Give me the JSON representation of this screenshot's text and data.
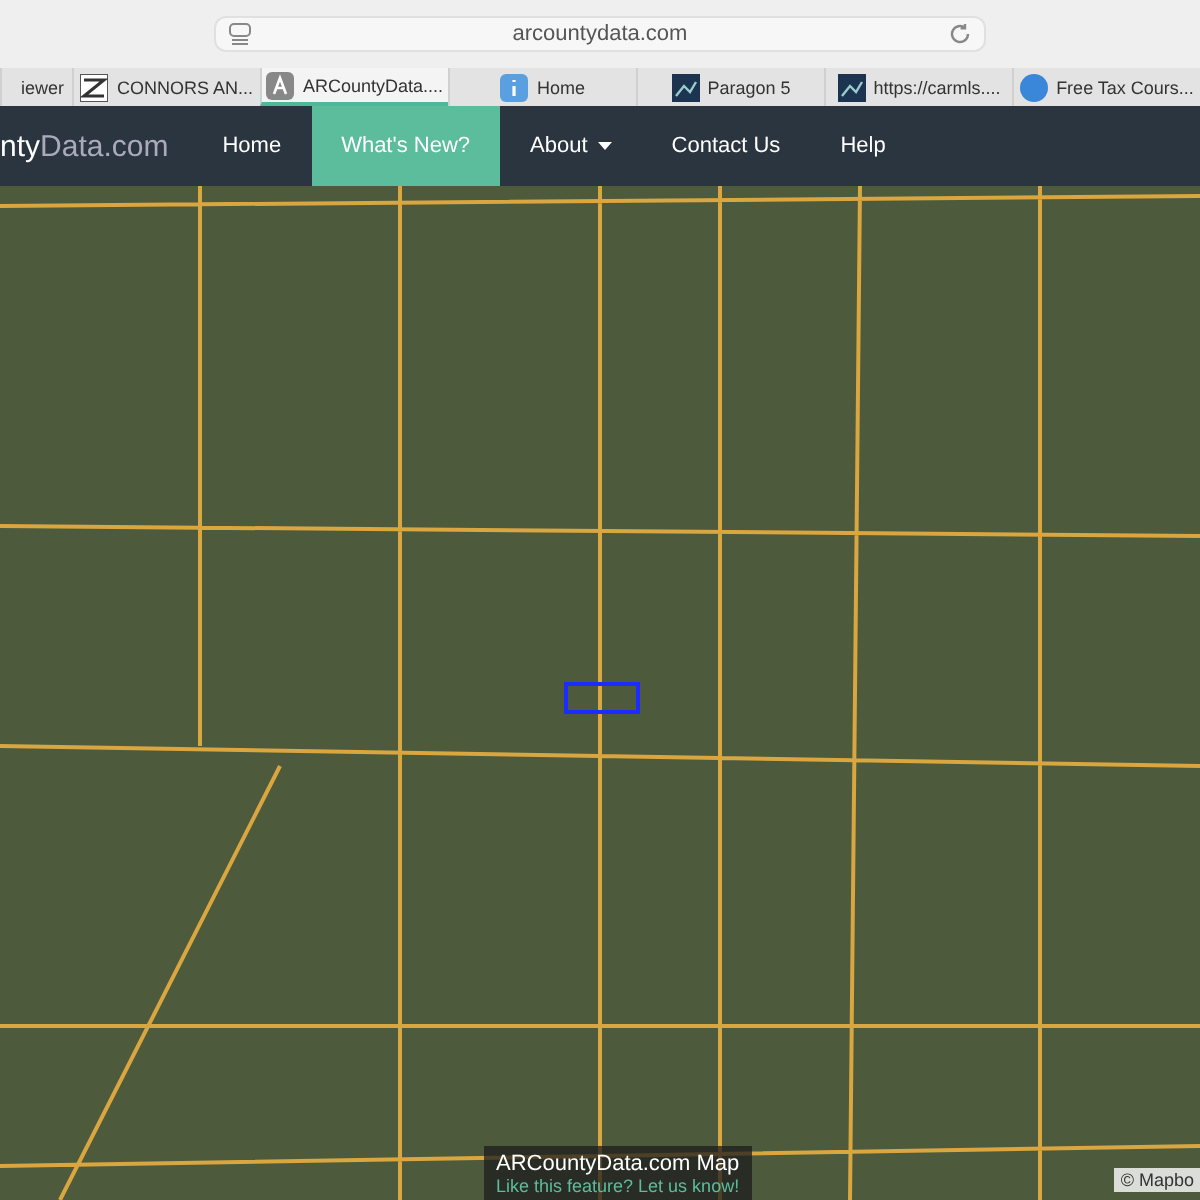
{
  "browser": {
    "address": "arcountydata.com",
    "tabs": [
      {
        "label": "iewer",
        "kind": "plain",
        "selected": false
      },
      {
        "label": "CONNORS AN...",
        "kind": "z",
        "selected": false
      },
      {
        "label": "ARCountyData....",
        "kind": "a",
        "selected": true
      },
      {
        "label": "Home",
        "kind": "info",
        "selected": false
      },
      {
        "label": "Paragon 5",
        "kind": "chart",
        "selected": false
      },
      {
        "label": "https://carmls....",
        "kind": "chart",
        "selected": false
      },
      {
        "label": "Free Tax Cours...",
        "kind": "globe",
        "selected": false
      }
    ]
  },
  "navbar": {
    "logo_start": "nty",
    "logo_end": "Data.com",
    "items": [
      {
        "label": "Home",
        "selected": false,
        "dropdown": false
      },
      {
        "label": "What's New?",
        "selected": true,
        "dropdown": false
      },
      {
        "label": "About",
        "selected": false,
        "dropdown": true
      },
      {
        "label": "Contact Us",
        "selected": false,
        "dropdown": false
      },
      {
        "label": "Help",
        "selected": false,
        "dropdown": false
      }
    ]
  },
  "map": {
    "caption_title": "ARCountyData.com Map",
    "caption_link": "Like this feature? Let us know!",
    "attribution": "© Mapbo"
  }
}
